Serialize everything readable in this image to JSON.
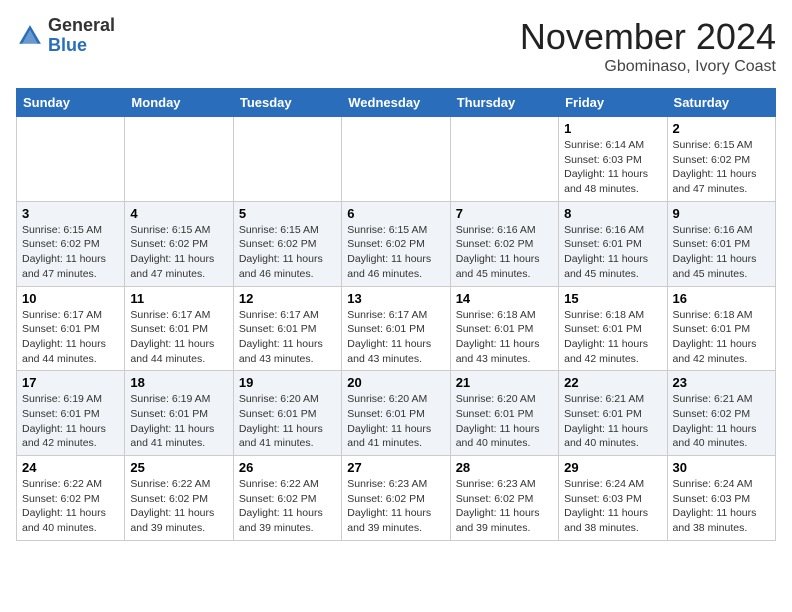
{
  "header": {
    "logo": {
      "line1": "General",
      "line2": "Blue"
    },
    "month": "November 2024",
    "location": "Gbominaso, Ivory Coast"
  },
  "weekdays": [
    "Sunday",
    "Monday",
    "Tuesday",
    "Wednesday",
    "Thursday",
    "Friday",
    "Saturday"
  ],
  "weeks": [
    [
      {
        "day": "",
        "info": ""
      },
      {
        "day": "",
        "info": ""
      },
      {
        "day": "",
        "info": ""
      },
      {
        "day": "",
        "info": ""
      },
      {
        "day": "",
        "info": ""
      },
      {
        "day": "1",
        "info": "Sunrise: 6:14 AM\nSunset: 6:03 PM\nDaylight: 11 hours and 48 minutes."
      },
      {
        "day": "2",
        "info": "Sunrise: 6:15 AM\nSunset: 6:02 PM\nDaylight: 11 hours and 47 minutes."
      }
    ],
    [
      {
        "day": "3",
        "info": "Sunrise: 6:15 AM\nSunset: 6:02 PM\nDaylight: 11 hours and 47 minutes."
      },
      {
        "day": "4",
        "info": "Sunrise: 6:15 AM\nSunset: 6:02 PM\nDaylight: 11 hours and 47 minutes."
      },
      {
        "day": "5",
        "info": "Sunrise: 6:15 AM\nSunset: 6:02 PM\nDaylight: 11 hours and 46 minutes."
      },
      {
        "day": "6",
        "info": "Sunrise: 6:15 AM\nSunset: 6:02 PM\nDaylight: 11 hours and 46 minutes."
      },
      {
        "day": "7",
        "info": "Sunrise: 6:16 AM\nSunset: 6:02 PM\nDaylight: 11 hours and 45 minutes."
      },
      {
        "day": "8",
        "info": "Sunrise: 6:16 AM\nSunset: 6:01 PM\nDaylight: 11 hours and 45 minutes."
      },
      {
        "day": "9",
        "info": "Sunrise: 6:16 AM\nSunset: 6:01 PM\nDaylight: 11 hours and 45 minutes."
      }
    ],
    [
      {
        "day": "10",
        "info": "Sunrise: 6:17 AM\nSunset: 6:01 PM\nDaylight: 11 hours and 44 minutes."
      },
      {
        "day": "11",
        "info": "Sunrise: 6:17 AM\nSunset: 6:01 PM\nDaylight: 11 hours and 44 minutes."
      },
      {
        "day": "12",
        "info": "Sunrise: 6:17 AM\nSunset: 6:01 PM\nDaylight: 11 hours and 43 minutes."
      },
      {
        "day": "13",
        "info": "Sunrise: 6:17 AM\nSunset: 6:01 PM\nDaylight: 11 hours and 43 minutes."
      },
      {
        "day": "14",
        "info": "Sunrise: 6:18 AM\nSunset: 6:01 PM\nDaylight: 11 hours and 43 minutes."
      },
      {
        "day": "15",
        "info": "Sunrise: 6:18 AM\nSunset: 6:01 PM\nDaylight: 11 hours and 42 minutes."
      },
      {
        "day": "16",
        "info": "Sunrise: 6:18 AM\nSunset: 6:01 PM\nDaylight: 11 hours and 42 minutes."
      }
    ],
    [
      {
        "day": "17",
        "info": "Sunrise: 6:19 AM\nSunset: 6:01 PM\nDaylight: 11 hours and 42 minutes."
      },
      {
        "day": "18",
        "info": "Sunrise: 6:19 AM\nSunset: 6:01 PM\nDaylight: 11 hours and 41 minutes."
      },
      {
        "day": "19",
        "info": "Sunrise: 6:20 AM\nSunset: 6:01 PM\nDaylight: 11 hours and 41 minutes."
      },
      {
        "day": "20",
        "info": "Sunrise: 6:20 AM\nSunset: 6:01 PM\nDaylight: 11 hours and 41 minutes."
      },
      {
        "day": "21",
        "info": "Sunrise: 6:20 AM\nSunset: 6:01 PM\nDaylight: 11 hours and 40 minutes."
      },
      {
        "day": "22",
        "info": "Sunrise: 6:21 AM\nSunset: 6:01 PM\nDaylight: 11 hours and 40 minutes."
      },
      {
        "day": "23",
        "info": "Sunrise: 6:21 AM\nSunset: 6:02 PM\nDaylight: 11 hours and 40 minutes."
      }
    ],
    [
      {
        "day": "24",
        "info": "Sunrise: 6:22 AM\nSunset: 6:02 PM\nDaylight: 11 hours and 40 minutes."
      },
      {
        "day": "25",
        "info": "Sunrise: 6:22 AM\nSunset: 6:02 PM\nDaylight: 11 hours and 39 minutes."
      },
      {
        "day": "26",
        "info": "Sunrise: 6:22 AM\nSunset: 6:02 PM\nDaylight: 11 hours and 39 minutes."
      },
      {
        "day": "27",
        "info": "Sunrise: 6:23 AM\nSunset: 6:02 PM\nDaylight: 11 hours and 39 minutes."
      },
      {
        "day": "28",
        "info": "Sunrise: 6:23 AM\nSunset: 6:02 PM\nDaylight: 11 hours and 39 minutes."
      },
      {
        "day": "29",
        "info": "Sunrise: 6:24 AM\nSunset: 6:03 PM\nDaylight: 11 hours and 38 minutes."
      },
      {
        "day": "30",
        "info": "Sunrise: 6:24 AM\nSunset: 6:03 PM\nDaylight: 11 hours and 38 minutes."
      }
    ]
  ]
}
